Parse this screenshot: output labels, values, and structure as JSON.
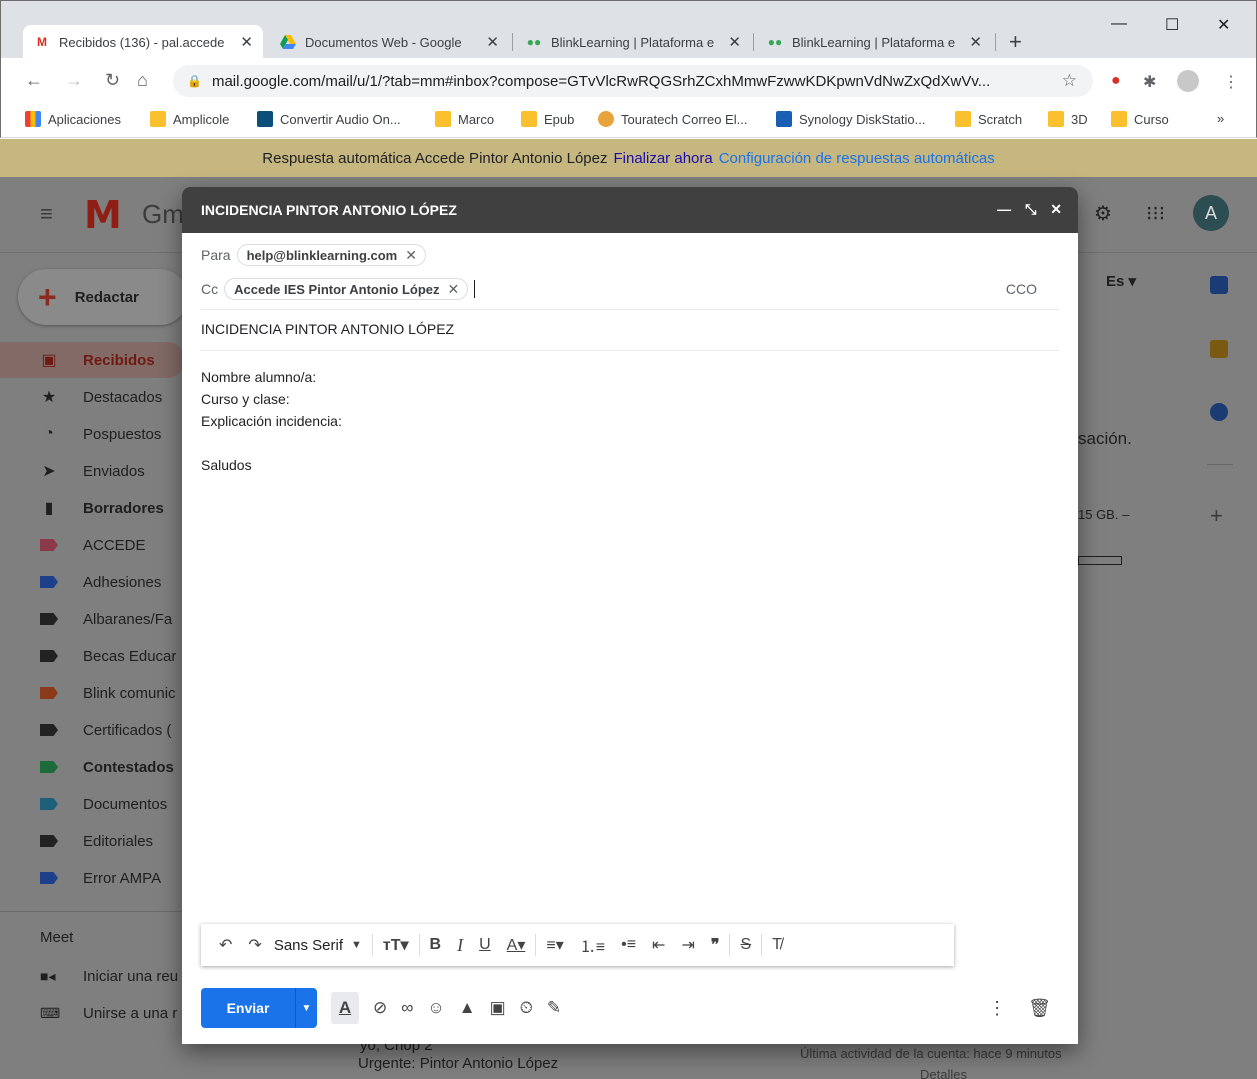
{
  "browser": {
    "tabs": [
      {
        "title": "Recibidos (136) - pal.accede",
        "icon": "gmail-icon",
        "active": true
      },
      {
        "title": "Documentos Web - Google",
        "icon": "drive-icon",
        "active": false
      },
      {
        "title": "BlinkLearning | Plataforma e",
        "icon": "blink-icon",
        "active": false
      },
      {
        "title": "BlinkLearning | Plataforma e",
        "icon": "blink-icon",
        "active": false
      }
    ],
    "new_tab": "+",
    "url": "mail.google.com/mail/u/1/?tab=mm#inbox?compose=GTvVlcRwRQGSrhZCxhMmwFzwwKDKpwnVdNwZxQdXwVv...",
    "bookmarks": [
      "Aplicaciones",
      "Amplicole",
      "Convertir Audio On...",
      "Marco",
      "Epub",
      "Touratech Correo El...",
      "Synology DiskStatio...",
      "Scratch",
      "3D",
      "Curso"
    ],
    "bookmarks_more": "»"
  },
  "banner": {
    "text": "Respuesta automática Accede Pintor Antonio López",
    "link1": "Finalizar ahora",
    "link2": "Configuración de respuestas automáticas"
  },
  "gmail": {
    "logo_text": "Gm",
    "compose_label": "Redactar",
    "avatar_letter": "A",
    "lang_fragment": "Es ▾",
    "nav": [
      {
        "label": "Recibidos",
        "icon": "inbox-icon",
        "active": true,
        "bold": true
      },
      {
        "label": "Destacados",
        "icon": "star-icon"
      },
      {
        "label": "Pospuestos",
        "icon": "clock-icon"
      },
      {
        "label": "Enviados",
        "icon": "send-icon"
      },
      {
        "label": "Borradores",
        "icon": "draft-icon",
        "bold": true
      },
      {
        "label": "ACCEDE",
        "icon": "label-icon",
        "color": "#8b3a4a"
      },
      {
        "label": "Adhesiones",
        "icon": "label-icon",
        "color": "#1e3f8a"
      },
      {
        "label": "Albaranes/Fa",
        "icon": "label-icon",
        "color": "#222222"
      },
      {
        "label": "Becas Educar",
        "icon": "label-icon",
        "color": "#222222"
      },
      {
        "label": "Blink comunic",
        "icon": "label-icon",
        "color": "#8a3a1a"
      },
      {
        "label": "Certificados (",
        "icon": "label-icon",
        "color": "#222222"
      },
      {
        "label": "Contestados",
        "icon": "label-icon",
        "color": "#1d6b3a",
        "bold": true
      },
      {
        "label": "Documentos",
        "icon": "label-icon",
        "color": "#1e5f7a"
      },
      {
        "label": "Editoriales",
        "icon": "label-icon",
        "color": "#222222"
      },
      {
        "label": "Error AMPA",
        "icon": "label-icon",
        "color": "#1e3f8a"
      }
    ],
    "meet_title": "Meet",
    "meet_items": [
      {
        "label": "Iniciar una reu",
        "icon": "video-icon"
      },
      {
        "label": "Unirse a una r",
        "icon": "keyboard-icon"
      }
    ],
    "right_fragments": {
      "conversation": "sación.",
      "storage": "15 GB. –",
      "activity": "Última actividad de la cuenta: hace 9 minutos",
      "details": "Detalles",
      "preview_from": "yo, Chop 2",
      "preview_subject": "Urgente: Pintor Antonio López"
    }
  },
  "compose": {
    "title": "INCIDENCIA PINTOR ANTONIO LÓPEZ",
    "to_label": "Para",
    "to_chip": "help@blinklearning.com",
    "cc_label": "Cc",
    "cc_chip": "Accede IES Pintor Antonio López",
    "bcc_label": "CCO",
    "subject": "INCIDENCIA PINTOR ANTONIO LÓPEZ",
    "body": [
      "Nombre alumno/a:",
      "Curso y clase:",
      "Explicación incidencia:",
      "",
      "Saludos"
    ],
    "font_select": "Sans Serif",
    "send_label": "Enviar"
  }
}
